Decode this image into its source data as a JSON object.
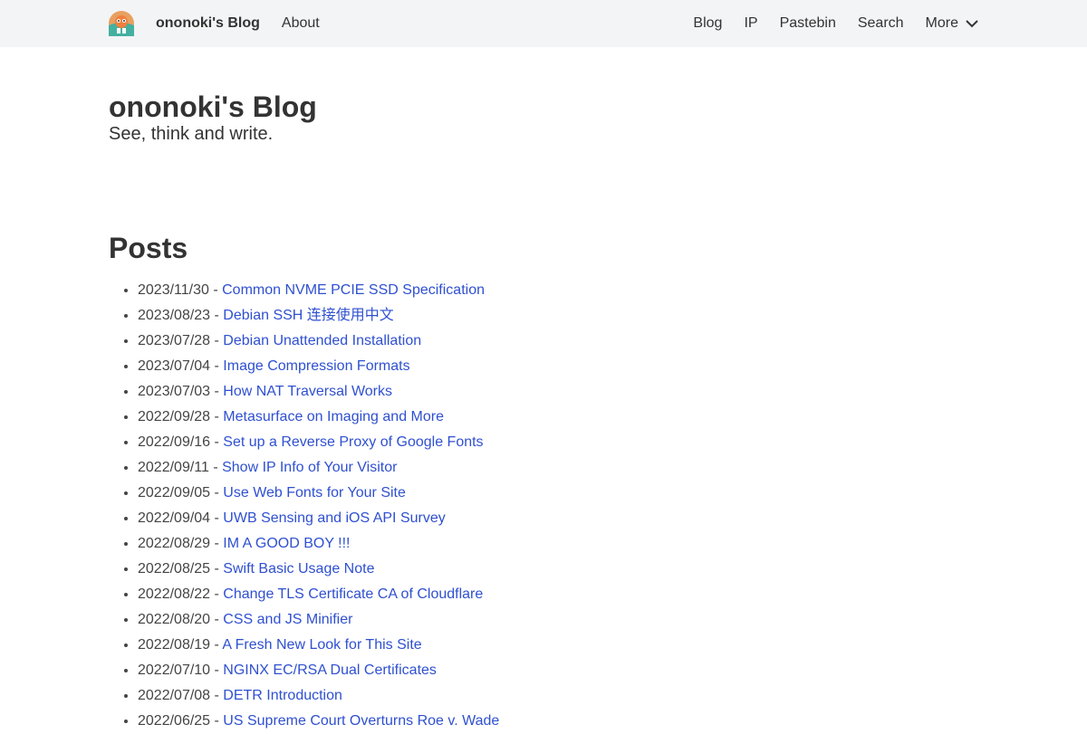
{
  "nav": {
    "brand": "ononoki's Blog",
    "about": "About",
    "links": [
      "Blog",
      "IP",
      "Pastebin",
      "Search"
    ],
    "more": "More"
  },
  "header": {
    "title": "ononoki's Blog",
    "tagline": "See, think and write."
  },
  "posts_section": {
    "title": "Posts",
    "items": [
      {
        "date": "2023/11/30",
        "title": "Common NVME PCIE SSD Specification"
      },
      {
        "date": "2023/08/23",
        "title": "Debian SSH 连接使用中文"
      },
      {
        "date": "2023/07/28",
        "title": "Debian Unattended Installation"
      },
      {
        "date": "2023/07/04",
        "title": "Image Compression Formats"
      },
      {
        "date": "2023/07/03",
        "title": "How NAT Traversal Works"
      },
      {
        "date": "2022/09/28",
        "title": "Metasurface on Imaging and More"
      },
      {
        "date": "2022/09/16",
        "title": "Set up a Reverse Proxy of Google Fonts"
      },
      {
        "date": "2022/09/11",
        "title": "Show IP Info of Your Visitor"
      },
      {
        "date": "2022/09/05",
        "title": "Use Web Fonts for Your Site"
      },
      {
        "date": "2022/09/04",
        "title": "UWB Sensing and iOS API Survey"
      },
      {
        "date": "2022/08/29",
        "title": "IM A GOOD BOY !!!"
      },
      {
        "date": "2022/08/25",
        "title": "Swift Basic Usage Note"
      },
      {
        "date": "2022/08/22",
        "title": "Change TLS Certificate CA of Cloudflare"
      },
      {
        "date": "2022/08/20",
        "title": "CSS and JS Minifier"
      },
      {
        "date": "2022/08/19",
        "title": "A Fresh New Look for This Site"
      },
      {
        "date": "2022/07/10",
        "title": "NGINX EC/RSA Dual Certificates"
      },
      {
        "date": "2022/07/08",
        "title": "DETR Introduction"
      },
      {
        "date": "2022/06/25",
        "title": "US Supreme Court Overturns Roe v. Wade"
      }
    ]
  },
  "colors": {
    "navbar_bg": "#f3f4f6",
    "link": "#2f50d0",
    "text": "#333333"
  },
  "icons": {
    "logo": "avatar-logo-icon",
    "more": "chevron-down-icon"
  }
}
